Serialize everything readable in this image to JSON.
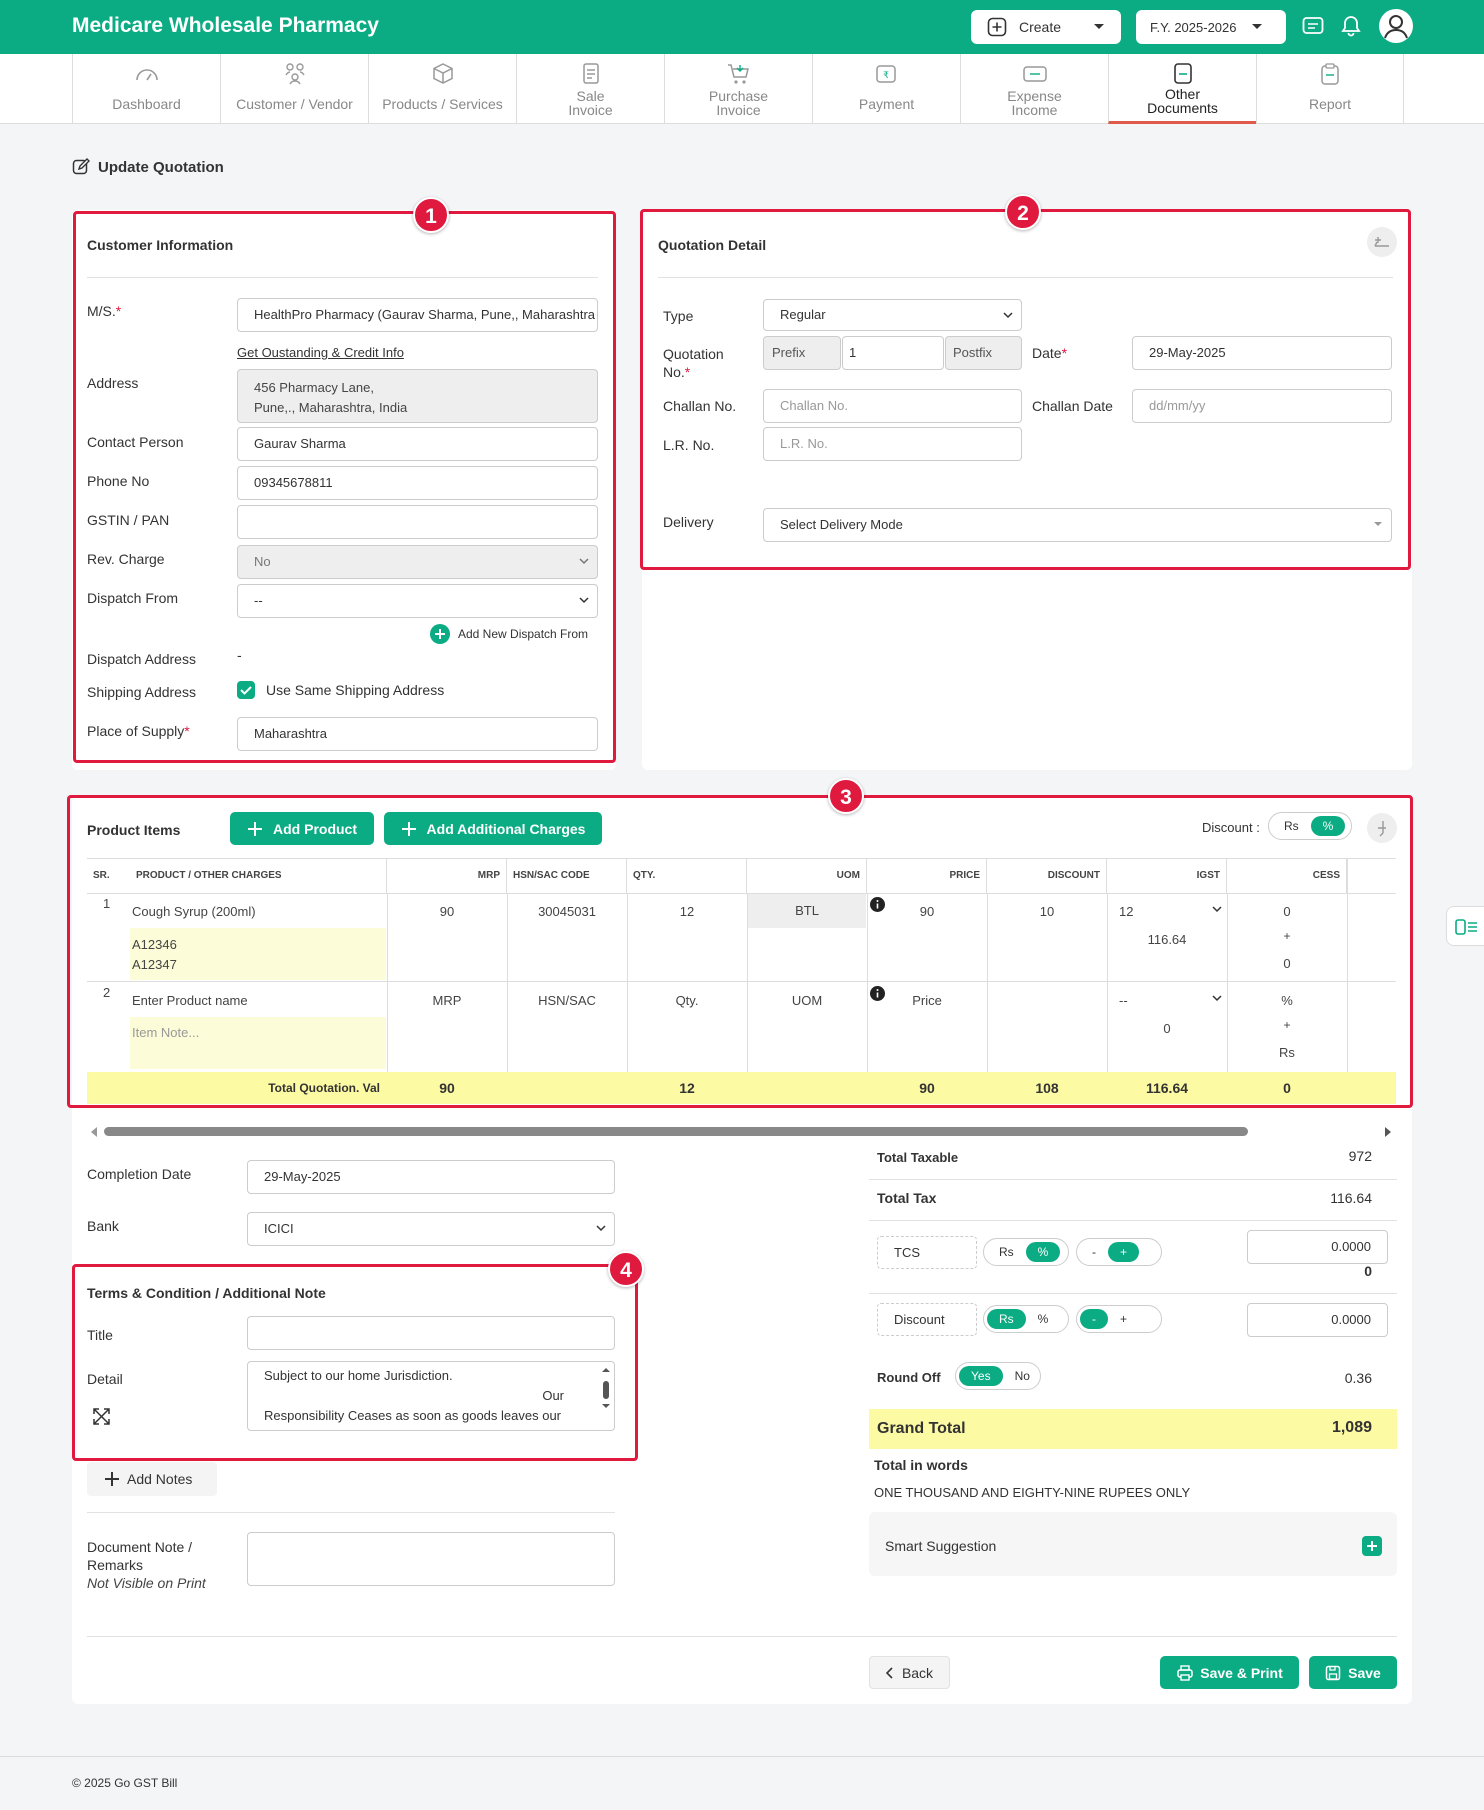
{
  "app": {
    "title": "Medicare Wholesale Pharmacy",
    "create_label": "Create",
    "fy_label": "F.Y. 2025-2026"
  },
  "nav": {
    "tabs": [
      {
        "label": "Dashboard"
      },
      {
        "label": "Customer / Vendor"
      },
      {
        "label": "Products / Services"
      },
      {
        "label": "Sale Invoice"
      },
      {
        "label": "Purchase Invoice"
      },
      {
        "label": "Payment"
      },
      {
        "label": "Expense Income"
      },
      {
        "label": "Other Documents"
      },
      {
        "label": "Report"
      }
    ]
  },
  "page": {
    "title": "Update Quotation"
  },
  "badges": [
    "1",
    "2",
    "3",
    "4"
  ],
  "customer": {
    "title": "Customer Information",
    "ms_label": "M/S.",
    "ms_value": "HealthPro Pharmacy (Gaurav Sharma, Pune,, Maharashtra",
    "credit_link": "Get Oustanding & Credit Info",
    "address_label": "Address",
    "address_line1": "456 Pharmacy Lane,",
    "address_line2": "Pune,., Maharashtra, India",
    "contact_label": "Contact Person",
    "contact_value": "Gaurav Sharma",
    "phone_label": "Phone No",
    "phone_value": "09345678811",
    "gstin_label": "GSTIN / PAN",
    "gstin_value": "",
    "rev_label": "Rev. Charge",
    "rev_value": "No",
    "dispatch_label": "Dispatch From",
    "dispatch_value": "--",
    "add_dispatch": "Add New Dispatch From",
    "dispatch_addr_label": "Dispatch Address",
    "dispatch_addr_value": "-",
    "shipping_label": "Shipping Address",
    "same_shipping": "Use Same Shipping Address",
    "pos_label": "Place of Supply",
    "pos_value": "Maharashtra"
  },
  "quotation": {
    "title": "Quotation Detail",
    "type_label": "Type",
    "type_value": "Regular",
    "no_label1": "Quotation",
    "no_label2": "No.",
    "prefix_ph": "Prefix",
    "no_value": "1",
    "postfix_ph": "Postfix",
    "date_label": "Date",
    "date_value": "29-May-2025",
    "challan_label": "Challan No.",
    "challan_ph": "Challan No.",
    "challan_date_label": "Challan Date",
    "challan_date_ph": "dd/mm/yy",
    "lr_label": "L.R. No.",
    "lr_ph": "L.R. No.",
    "delivery_label": "Delivery",
    "delivery_value": "Select Delivery Mode"
  },
  "products": {
    "title": "Product Items",
    "add_product": "Add Product",
    "add_charges": "Add Additional Charges",
    "discount_label": "Discount :",
    "disc_rs": "Rs",
    "disc_pct": "%",
    "headers": [
      "SR.",
      "PRODUCT / OTHER CHARGES",
      "MRP",
      "HSN/SAC CODE",
      "QTY.",
      "UOM",
      "PRICE",
      "DISCOUNT",
      "IGST",
      "CESS"
    ],
    "row1": {
      "sr": "1",
      "name": "Cough Syrup (200ml)",
      "mrp": "90",
      "hsn": "30045031",
      "qty": "12",
      "uom": "BTL",
      "price": "90",
      "discount": "10",
      "igst": "12",
      "igst_amt": "116.64",
      "cess_top": "0",
      "cess_plus": "+",
      "cess_bot": "0",
      "note1": "A12346",
      "note2": "A12347"
    },
    "row2": {
      "sr": "2",
      "name_ph": "Enter Product name",
      "mrp_ph": "MRP",
      "hsn_ph": "HSN/SAC",
      "qty_ph": "Qty.",
      "uom_ph": "UOM",
      "price_ph": "Price",
      "igst": "--",
      "igst_amt": "0",
      "cess_top": "%",
      "cess_plus": "+",
      "cess_bot": "Rs",
      "note_ph": "Item Note..."
    },
    "total": {
      "label": "Total Quotation. Val",
      "mrp": "90",
      "qty": "12",
      "price": "90",
      "discount": "108",
      "igst": "116.64",
      "cess": "0"
    }
  },
  "bottom": {
    "completion_label": "Completion Date",
    "completion_value": "29-May-2025",
    "bank_label": "Bank",
    "bank_value": "ICICI",
    "terms_title": "Terms & Condition / Additional Note",
    "title_label": "Title",
    "detail_label": "Detail",
    "detail_line1": "Subject to our home Jurisdiction.",
    "detail_line2": "Our",
    "detail_line3": "Responsibility Ceases as soon as goods leaves our",
    "add_notes": "Add Notes",
    "doc_note_label1": "Document Note /",
    "doc_note_label2": "Remarks",
    "doc_note_hint": "Not Visible on Print"
  },
  "summary": {
    "taxable_label": "Total Taxable",
    "taxable_value": "972",
    "tax_label": "Total Tax",
    "tax_value": "116.64",
    "tcs_label": "TCS",
    "tcs_rs": "Rs",
    "tcs_pct": "%",
    "tcs_minus": "-",
    "tcs_plus": "+",
    "tcs_value": "0.0000",
    "tcs_result": "0",
    "disc_label": "Discount",
    "disc_rs": "Rs",
    "disc_pct": "%",
    "disc_minus": "-",
    "disc_plus": "+",
    "disc_value": "0.0000",
    "round_label": "Round Off",
    "round_yes": "Yes",
    "round_no": "No",
    "round_value": "0.36",
    "grand_label": "Grand Total",
    "grand_value": "1,089",
    "words_label": "Total in words",
    "words_value": "ONE THOUSAND AND EIGHTY-NINE RUPEES ONLY",
    "smart_label": "Smart Suggestion"
  },
  "actions": {
    "back": "Back",
    "save_print": "Save & Print",
    "save": "Save"
  },
  "footer": {
    "copyright": "© 2025 Go GST Bill"
  },
  "colors": {
    "brand": "#0bac83",
    "highlight": "#e0193e",
    "total_row": "#fdfaa4"
  }
}
